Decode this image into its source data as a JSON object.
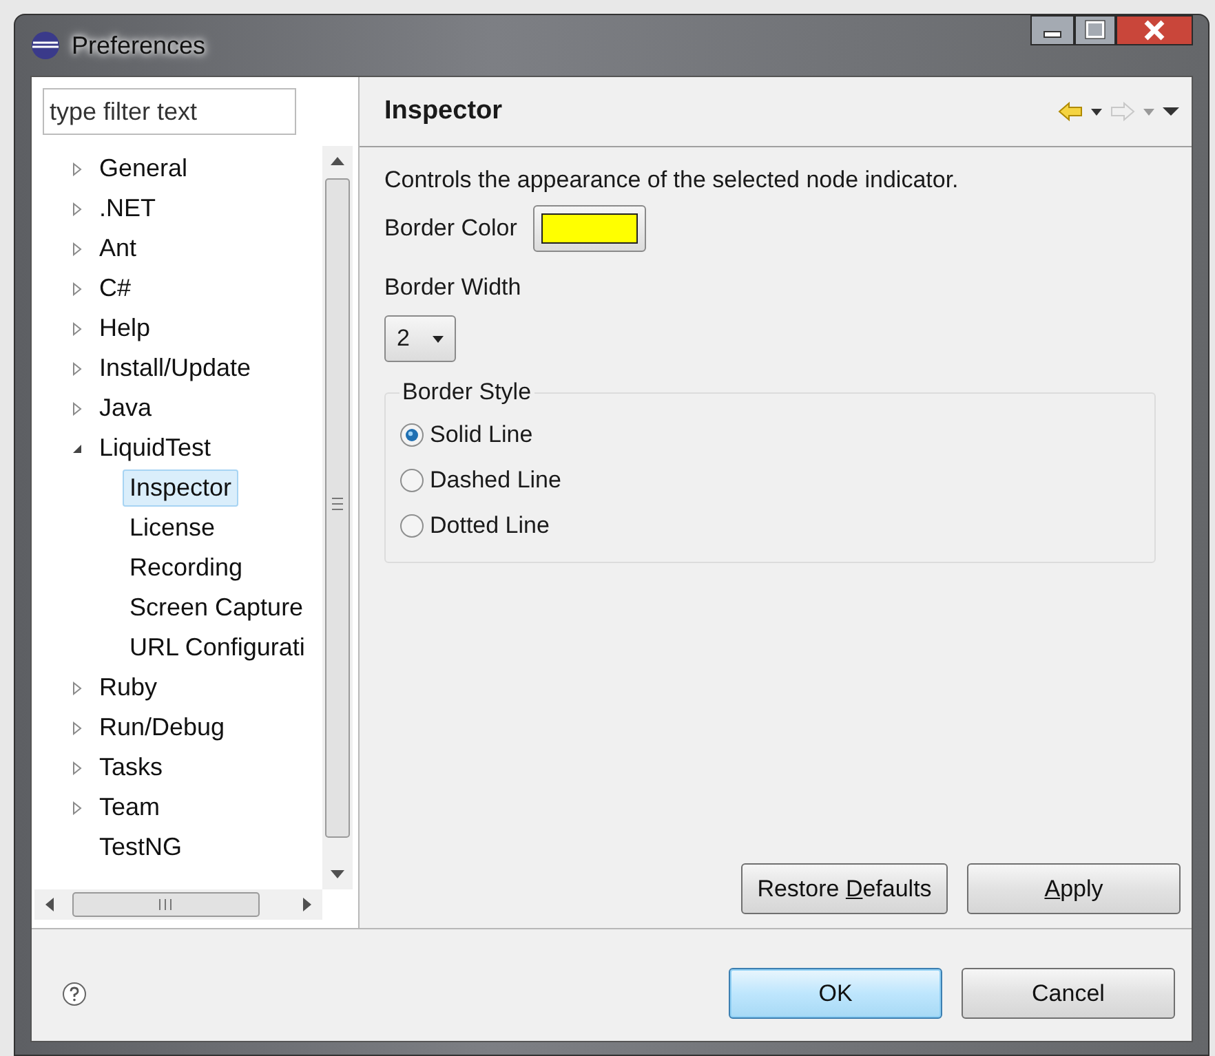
{
  "window": {
    "title": "Preferences"
  },
  "filter": {
    "placeholder": "type filter text"
  },
  "tree": [
    {
      "label": "General",
      "kind": "group",
      "expanded": false,
      "selected": false
    },
    {
      "label": ".NET",
      "kind": "group",
      "expanded": false,
      "selected": false
    },
    {
      "label": "Ant",
      "kind": "group",
      "expanded": false,
      "selected": false
    },
    {
      "label": "C#",
      "kind": "group",
      "expanded": false,
      "selected": false
    },
    {
      "label": "Help",
      "kind": "group",
      "expanded": false,
      "selected": false
    },
    {
      "label": "Install/Update",
      "kind": "group",
      "expanded": false,
      "selected": false
    },
    {
      "label": "Java",
      "kind": "group",
      "expanded": false,
      "selected": false
    },
    {
      "label": "LiquidTest",
      "kind": "group",
      "expanded": true,
      "selected": false,
      "children": [
        {
          "label": "Inspector",
          "selected": true
        },
        {
          "label": "License",
          "selected": false
        },
        {
          "label": "Recording",
          "selected": false
        },
        {
          "label": "Screen Capture",
          "selected": false
        },
        {
          "label": "URL Configurati",
          "selected": false
        }
      ]
    },
    {
      "label": "Ruby",
      "kind": "group",
      "expanded": false,
      "selected": false
    },
    {
      "label": "Run/Debug",
      "kind": "group",
      "expanded": false,
      "selected": false
    },
    {
      "label": "Tasks",
      "kind": "group",
      "expanded": false,
      "selected": false
    },
    {
      "label": "Team",
      "kind": "group",
      "expanded": false,
      "selected": false
    },
    {
      "label": "TestNG",
      "kind": "leaf",
      "selected": false
    }
  ],
  "page": {
    "title": "Inspector",
    "back_disabled": false,
    "forward_disabled": true,
    "description": "Controls the appearance of the selected node indicator.",
    "border_color": {
      "label": "Border Color",
      "color": "#ffff00"
    },
    "border_width": {
      "label": "Border Width",
      "value": "2"
    },
    "border_style": {
      "label": "Border Style",
      "options": [
        {
          "label": "Solid Line",
          "selected": true
        },
        {
          "label": "Dashed Line",
          "selected": false
        },
        {
          "label": "Dotted Line",
          "selected": false
        }
      ]
    },
    "buttons": [
      {
        "before": "Restore ",
        "mnemonic": "D",
        "after": "efaults"
      },
      {
        "mnemonic": "A",
        "after": "pply"
      }
    ]
  },
  "dialog_buttons": [
    {
      "label": "OK",
      "default": true
    },
    {
      "label": "Cancel",
      "default": false
    }
  ]
}
